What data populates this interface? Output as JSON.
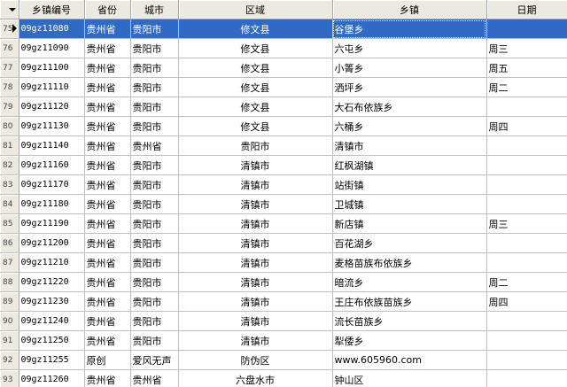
{
  "headers": {
    "town_id": "乡镇编号",
    "province": "省份",
    "city": "城市",
    "region": "区域",
    "town": "乡镇",
    "day": "日期"
  },
  "selected_row": 0,
  "rows": [
    {
      "index": "75",
      "town_id": "09gz11080",
      "province": "贵州省",
      "city": "贵阳市",
      "region": "修文县",
      "town": "谷堡乡",
      "day": ""
    },
    {
      "index": "76",
      "town_id": "09gz11090",
      "province": "贵州省",
      "city": "贵阳市",
      "region": "修文县",
      "town": "六屯乡",
      "day": "周三"
    },
    {
      "index": "77",
      "town_id": "09gz11100",
      "province": "贵州省",
      "city": "贵阳市",
      "region": "修文县",
      "town": "小箐乡",
      "day": "周五"
    },
    {
      "index": "78",
      "town_id": "09gz11110",
      "province": "贵州省",
      "city": "贵阳市",
      "region": "修文县",
      "town": "洒坪乡",
      "day": "周二"
    },
    {
      "index": "79",
      "town_id": "09gz11120",
      "province": "贵州省",
      "city": "贵阳市",
      "region": "修文县",
      "town": "大石布依族乡",
      "day": ""
    },
    {
      "index": "80",
      "town_id": "09gz11130",
      "province": "贵州省",
      "city": "贵阳市",
      "region": "修文县",
      "town": "六桶乡",
      "day": "周四"
    },
    {
      "index": "81",
      "town_id": "09gz11140",
      "province": "贵州省",
      "city": "贵州省",
      "region": "贵阳市",
      "town": "清镇市",
      "day": ""
    },
    {
      "index": "82",
      "town_id": "09gz11160",
      "province": "贵州省",
      "city": "贵阳市",
      "region": "清镇市",
      "town": "红枫湖镇",
      "day": ""
    },
    {
      "index": "83",
      "town_id": "09gz11170",
      "province": "贵州省",
      "city": "贵阳市",
      "region": "清镇市",
      "town": "站街镇",
      "day": ""
    },
    {
      "index": "84",
      "town_id": "09gz11180",
      "province": "贵州省",
      "city": "贵阳市",
      "region": "清镇市",
      "town": "卫城镇",
      "day": ""
    },
    {
      "index": "85",
      "town_id": "09gz11190",
      "province": "贵州省",
      "city": "贵阳市",
      "region": "清镇市",
      "town": "新店镇",
      "day": "周三"
    },
    {
      "index": "86",
      "town_id": "09gz11200",
      "province": "贵州省",
      "city": "贵阳市",
      "region": "清镇市",
      "town": "百花湖乡",
      "day": ""
    },
    {
      "index": "87",
      "town_id": "09gz11210",
      "province": "贵州省",
      "city": "贵阳市",
      "region": "清镇市",
      "town": "麦格苗族布依族乡",
      "day": ""
    },
    {
      "index": "88",
      "town_id": "09gz11220",
      "province": "贵州省",
      "city": "贵阳市",
      "region": "清镇市",
      "town": "暗流乡",
      "day": "周二"
    },
    {
      "index": "89",
      "town_id": "09gz11230",
      "province": "贵州省",
      "city": "贵阳市",
      "region": "清镇市",
      "town": "王庄布依族苗族乡",
      "day": "周四"
    },
    {
      "index": "90",
      "town_id": "09gz11240",
      "province": "贵州省",
      "city": "贵阳市",
      "region": "清镇市",
      "town": "流长苗族乡",
      "day": ""
    },
    {
      "index": "91",
      "town_id": "09gz11250",
      "province": "贵州省",
      "city": "贵阳市",
      "region": "清镇市",
      "town": "犁倭乡",
      "day": ""
    },
    {
      "index": "92",
      "town_id": "09gz11255",
      "province": "原创",
      "city": "爱风无声",
      "region": "防伪区",
      "town": "www.605960.com",
      "day": ""
    },
    {
      "index": "93",
      "town_id": "09gz11260",
      "province": "贵州省",
      "city": "贵州省",
      "region": "六盘水市",
      "town": "钟山区",
      "day": ""
    }
  ]
}
